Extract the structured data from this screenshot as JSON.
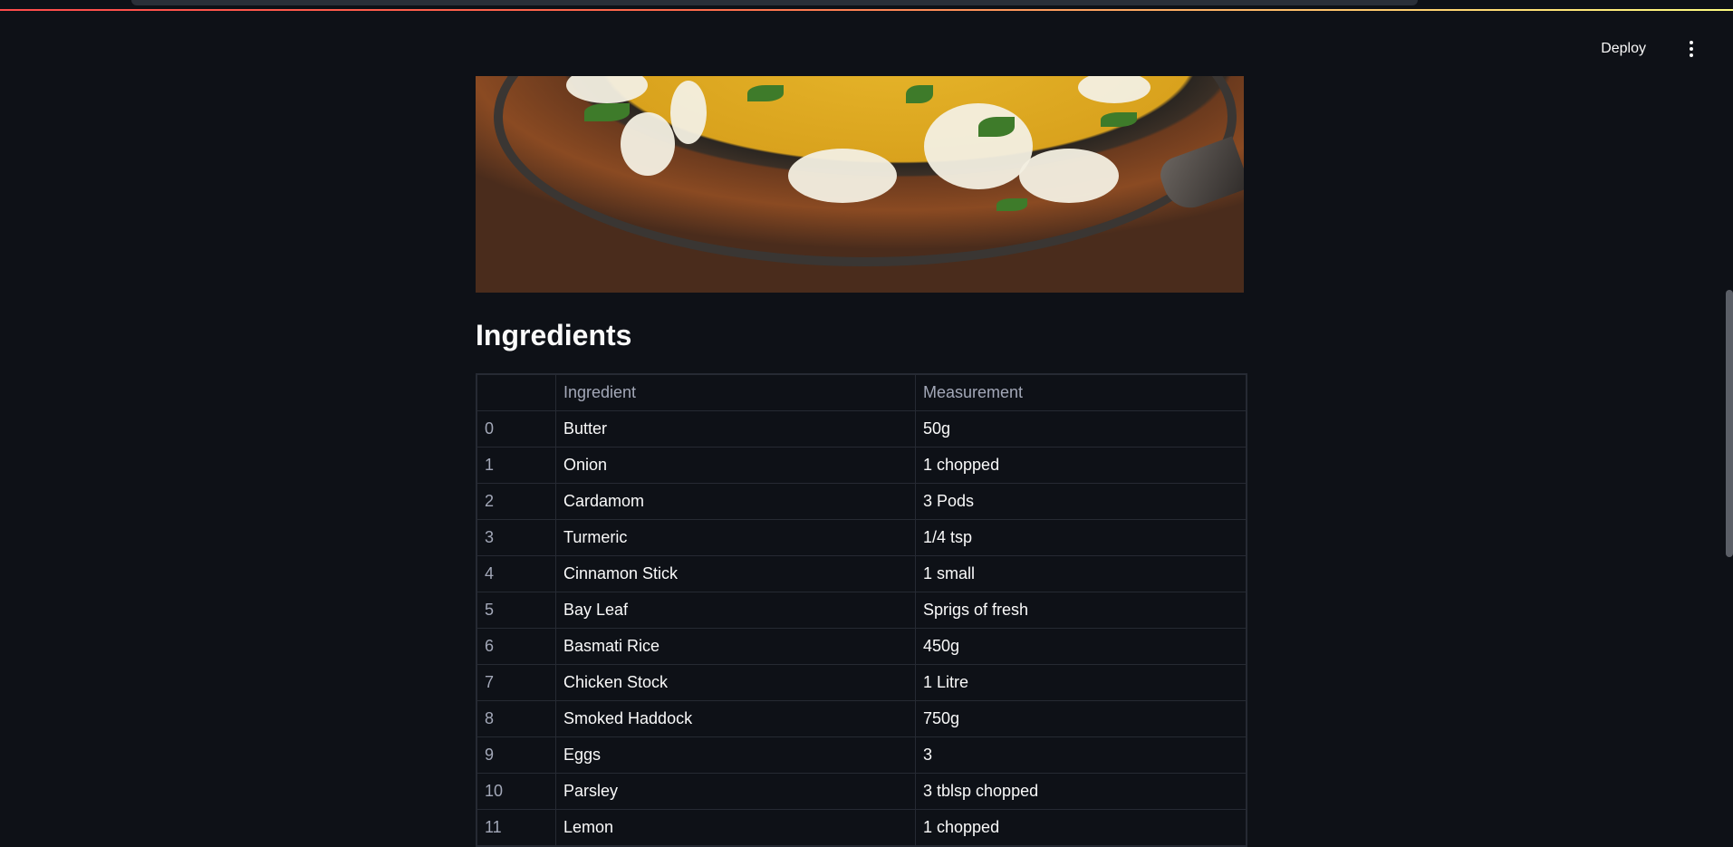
{
  "header": {
    "deploy_label": "Deploy"
  },
  "main": {
    "section_title": "Ingredients",
    "table": {
      "columns": [
        "",
        "Ingredient",
        "Measurement"
      ],
      "rows": [
        {
          "index": "0",
          "ingredient": "Butter",
          "measurement": "50g"
        },
        {
          "index": "1",
          "ingredient": "Onion",
          "measurement": "1 chopped"
        },
        {
          "index": "2",
          "ingredient": "Cardamom",
          "measurement": "3 Pods"
        },
        {
          "index": "3",
          "ingredient": "Turmeric",
          "measurement": "1/4 tsp"
        },
        {
          "index": "4",
          "ingredient": "Cinnamon Stick",
          "measurement": "1 small"
        },
        {
          "index": "5",
          "ingredient": "Bay Leaf",
          "measurement": "Sprigs of fresh"
        },
        {
          "index": "6",
          "ingredient": "Basmati Rice",
          "measurement": "450g"
        },
        {
          "index": "7",
          "ingredient": "Chicken Stock",
          "measurement": "1 Litre"
        },
        {
          "index": "8",
          "ingredient": "Smoked Haddock",
          "measurement": "750g"
        },
        {
          "index": "9",
          "ingredient": "Eggs",
          "measurement": "3"
        },
        {
          "index": "10",
          "ingredient": "Parsley",
          "measurement": "3 tblsp chopped"
        },
        {
          "index": "11",
          "ingredient": "Lemon",
          "measurement": "1 chopped"
        }
      ]
    }
  },
  "icons": {
    "menu": "vertical-ellipsis-icon"
  },
  "colors": {
    "background": "#0e1117",
    "text": "#fafafa",
    "muted_text": "#a3a8b8",
    "table_border": "#262a33"
  }
}
